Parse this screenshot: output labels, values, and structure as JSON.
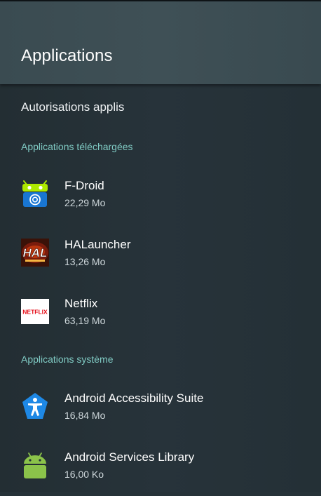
{
  "header": {
    "title": "Applications"
  },
  "permissions": {
    "label": "Autorisations applis"
  },
  "sections": {
    "downloaded": "Applications téléchargées",
    "system": "Applications système"
  },
  "downloaded_apps": [
    {
      "name": "F-Droid",
      "size": "22,29 Mo",
      "icon": "fdroid-icon"
    },
    {
      "name": "HALauncher",
      "size": "13,26 Mo",
      "icon": "halauncher-icon",
      "icon_text": "HAL"
    },
    {
      "name": "Netflix",
      "size": "63,19 Mo",
      "icon": "netflix-icon",
      "icon_text": "NETFLIX"
    }
  ],
  "system_apps": [
    {
      "name": "Android Accessibility Suite",
      "size": "16,84 Mo",
      "icon": "accessibility-icon"
    },
    {
      "name": "Android Services Library",
      "size": "16,00 Ko",
      "icon": "android-icon"
    }
  ],
  "colors": {
    "background": "#263238",
    "header": "#3d4e54",
    "accent": "#80cbc4",
    "fdroid_green": "#aeea00",
    "fdroid_blue": "#1976d2",
    "netflix_red": "#e50914",
    "accessibility_blue": "#1e88e5",
    "android_green": "#8bc34a"
  }
}
